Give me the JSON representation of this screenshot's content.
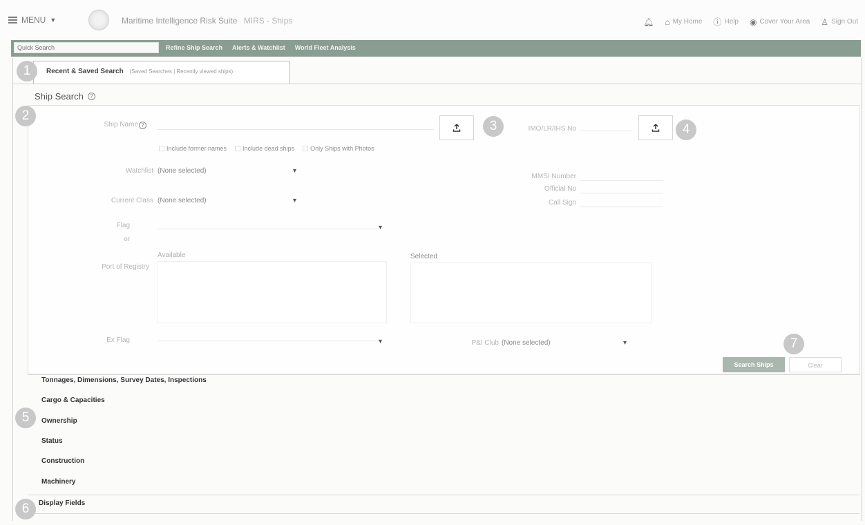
{
  "header": {
    "menu_label": "MENU",
    "app_title": "Maritime Intelligence Risk Suite",
    "app_section": "MIRS - Ships",
    "links": [
      {
        "label": "My Home",
        "icon": "home-icon"
      },
      {
        "label": "Help",
        "icon": "help-icon"
      },
      {
        "label": "Cover Your Area",
        "icon": "antenna-icon"
      },
      {
        "label": "Sign Out",
        "icon": "user-icon"
      }
    ]
  },
  "nav": {
    "quick_search_placeholder": "Quick Search",
    "links": [
      "Refine Ship Search",
      "Alerts & Watchlist",
      "World Fleet Analysis"
    ]
  },
  "recent_tab": {
    "label": "Recent & Saved Search",
    "sub": "(Saved Searches | Recently viewed ships)"
  },
  "ship_search": {
    "title": "Ship Search",
    "ship_name_label": "Ship Name",
    "imo_label": "IMO/LR/IHS No",
    "checkboxes": [
      "Include former names",
      "Include dead ships",
      "Only Ships with Photos"
    ],
    "watchlist_label": "Watchlist",
    "watchlist_value": "(None selected)",
    "current_class_label": "Current Class",
    "current_class_value": "(None selected)",
    "mmsi_label": "MMSI Number",
    "official_no_label": "Official No",
    "call_sign_label": "Call Sign",
    "flag_label": "Flag",
    "flag_label_2": "or",
    "available_label": "Available",
    "selected_label": "Selected",
    "port_label": "Port of Registry",
    "ex_flag_label": "Ex Flag",
    "pi_club_label": "P&I Club",
    "pi_club_value": "(None selected)",
    "search_button": "Search Ships",
    "clear_button": "Clear"
  },
  "accordions": [
    "Tonnages, Dimensions, Survey Dates, Inspections",
    "Cargo & Capacities",
    "Ownership",
    "Status",
    "Construction",
    "Machinery",
    "Display Fields"
  ],
  "callouts": [
    "1",
    "2",
    "3",
    "4",
    "5",
    "6",
    "7"
  ]
}
